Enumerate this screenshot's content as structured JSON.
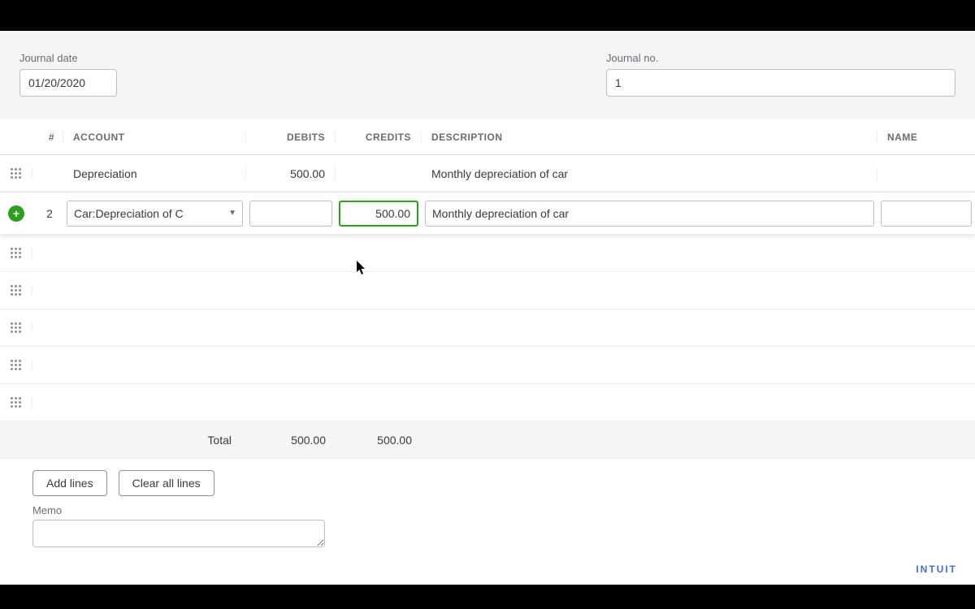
{
  "header": {
    "journal_date_label": "Journal date",
    "journal_date_value": "01/20/2020",
    "journal_no_label": "Journal no.",
    "journal_no_value": "1"
  },
  "columns": {
    "num": "#",
    "account": "ACCOUNT",
    "debits": "DEBITS",
    "credits": "CREDITS",
    "description": "DESCRIPTION",
    "name": "NAME"
  },
  "rows": {
    "r1": {
      "num": "",
      "account": "Depreciation",
      "debits": "500.00",
      "credits": "",
      "description": "Monthly depreciation of car",
      "name": ""
    },
    "r2": {
      "num": "2",
      "account": "Car:Depreciation of C",
      "debits": "",
      "credits": "500.00",
      "description": "Monthly depreciation of car",
      "name": ""
    }
  },
  "totals": {
    "label": "Total",
    "debits": "500.00",
    "credits": "500.00"
  },
  "buttons": {
    "add_lines": "Add lines",
    "clear_all": "Clear all lines"
  },
  "memo": {
    "label": "Memo",
    "value": ""
  },
  "brand": "INTUIT"
}
